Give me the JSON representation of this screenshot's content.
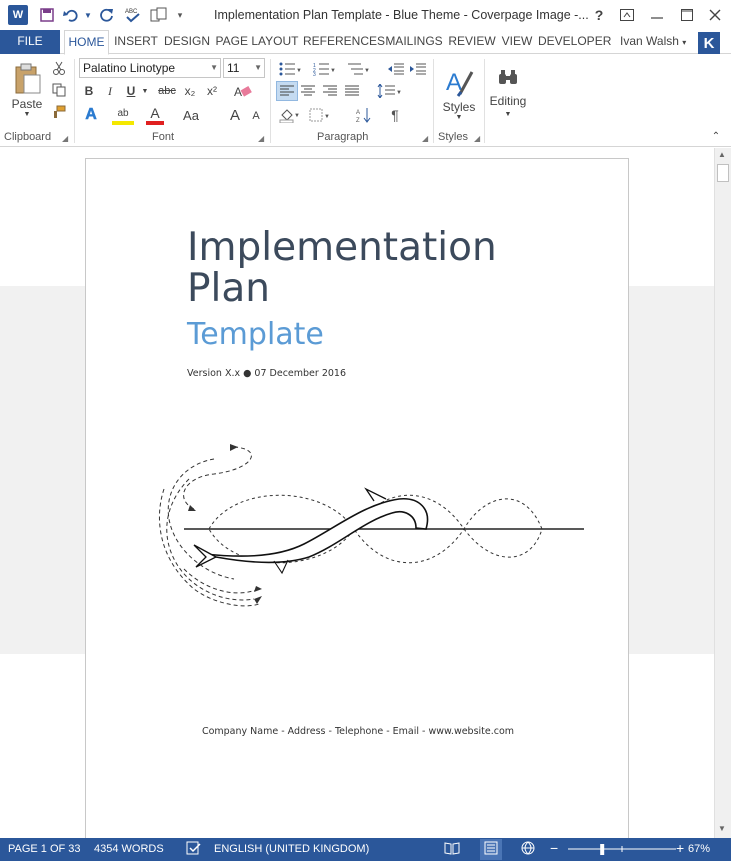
{
  "titlebar": {
    "doc_title": "Implementation Plan Template - Blue Theme - Coverpage Image -...",
    "help": "?",
    "word_letter": "W"
  },
  "tabs": [
    "FILE",
    "HOME",
    "INSERT",
    "DESIGN",
    "PAGE LAYOUT",
    "REFERENCES",
    "MAILINGS",
    "REVIEW",
    "VIEW",
    "DEVELOPER"
  ],
  "user": {
    "name": "Ivan Walsh",
    "initial": "K"
  },
  "ribbon": {
    "paste_label": "Paste",
    "font_name": "Palatino Linotype",
    "font_size": "11",
    "styles_label": "Styles",
    "editing_label": "Editing",
    "groups": {
      "clipboard": "Clipboard",
      "font": "Font",
      "paragraph": "Paragraph",
      "styles": "Styles"
    },
    "buttons": {
      "bold": "B",
      "italic": "I",
      "underline": "U",
      "strike": "abc",
      "subscript": "x₂",
      "superscript": "x²",
      "font_color": "A",
      "highlight": "ab",
      "text_effects": "A",
      "change_case": "Aa",
      "grow": "A",
      "shrink": "A",
      "show_marks": "¶"
    }
  },
  "document": {
    "title": "Implementation Plan",
    "subtitle": "Template",
    "version_line": "Version X.x ● 07 December 2016",
    "footer": "Company Name - Address - Telephone - Email - www.website.com"
  },
  "status": {
    "page": "PAGE 1 OF 33",
    "words": "4354 WORDS",
    "language": "ENGLISH (UNITED KINGDOM)",
    "zoom": "67%",
    "zoom_level": 0.67
  },
  "colors": {
    "accent": "#2b579a",
    "subtitle": "#5b9bd5",
    "title": "#3c4a5c"
  }
}
